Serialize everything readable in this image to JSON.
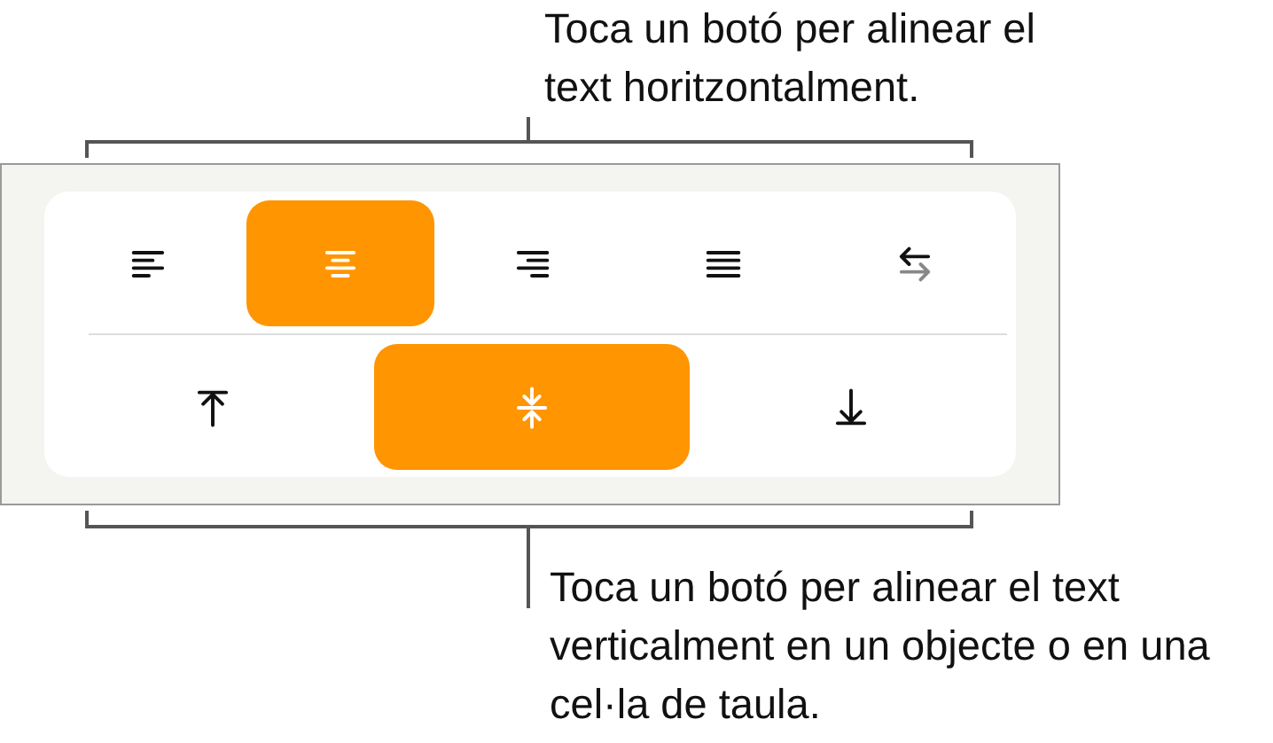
{
  "top_callout": "Toca un botó per alinear el text horitzontalment.",
  "horizontal_buttons": [
    {
      "kind": "left",
      "selected": false
    },
    {
      "kind": "center",
      "selected": true
    },
    {
      "kind": "right",
      "selected": false
    },
    {
      "kind": "justify",
      "selected": false
    },
    {
      "kind": "direction",
      "selected": false
    }
  ],
  "vertical_buttons": [
    {
      "kind": "top",
      "selected": false
    },
    {
      "kind": "middle",
      "selected": true
    },
    {
      "kind": "bottom",
      "selected": false
    }
  ],
  "bottom_callout": "Toca un botó per alinear el text verticalment en un objecte o en una cel·la de taula."
}
